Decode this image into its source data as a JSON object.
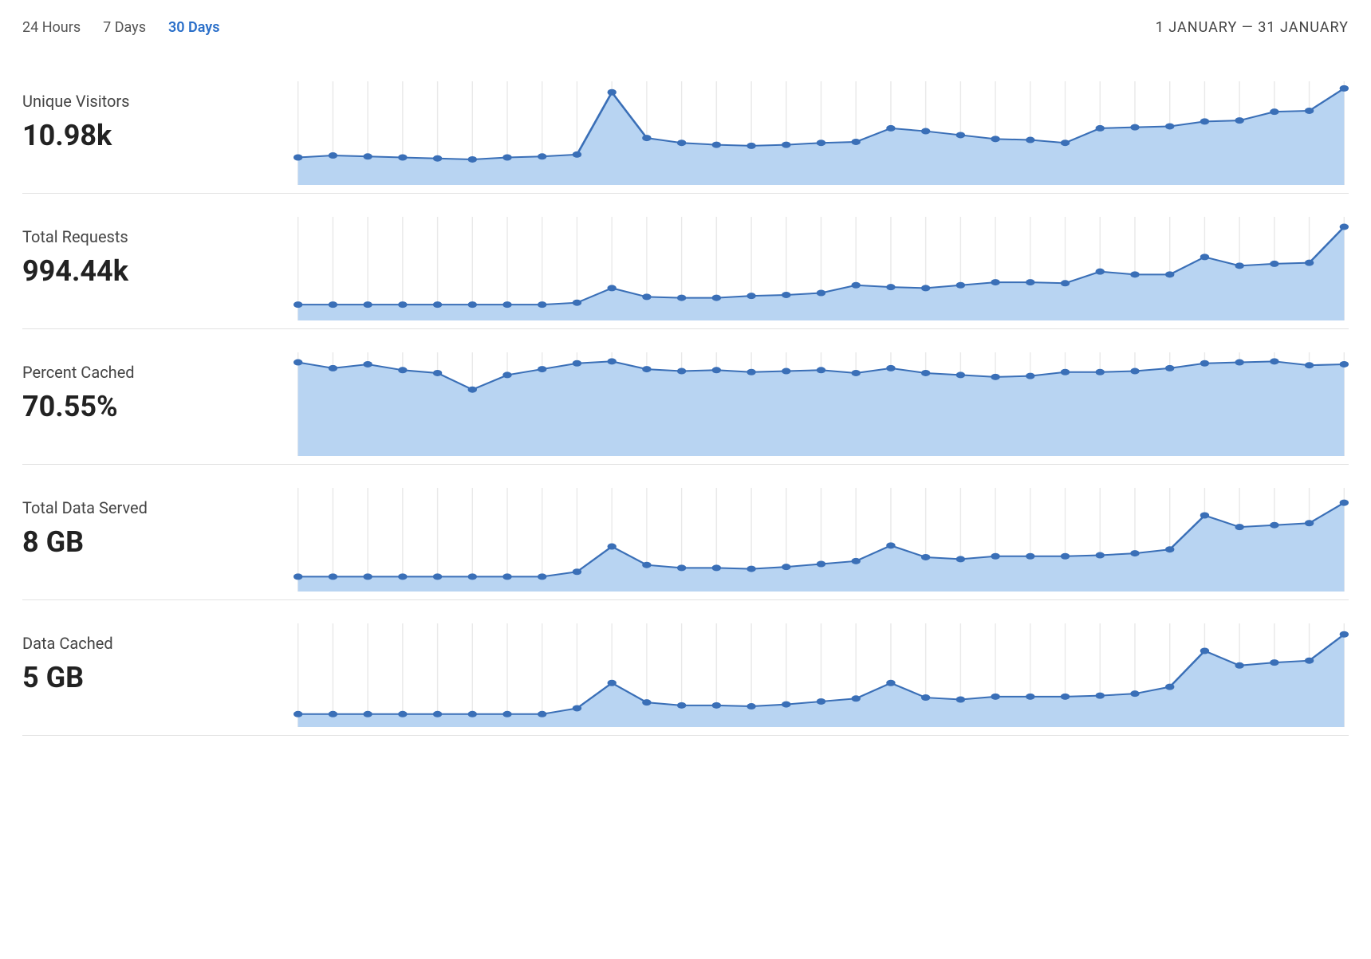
{
  "range_tabs": {
    "tab_24h": "24 Hours",
    "tab_7d": "7 Days",
    "tab_30d": "30 Days",
    "active": "tab_30d"
  },
  "date_range": "1 JANUARY — 31 JANUARY",
  "metrics": {
    "unique_visitors": {
      "title": "Unique Visitors",
      "value": "10.98k"
    },
    "total_requests": {
      "title": "Total Requests",
      "value": "994.44k"
    },
    "percent_cached": {
      "title": "Percent Cached",
      "value": "70.55%"
    },
    "total_data": {
      "title": "Total Data Served",
      "value": "8 GB"
    },
    "data_cached": {
      "title": "Data Cached",
      "value": "5 GB"
    }
  },
  "chart_data": [
    {
      "type": "area",
      "title": "Unique Visitors",
      "ylim": [
        0,
        100
      ],
      "x": [
        1,
        2,
        3,
        4,
        5,
        6,
        7,
        8,
        9,
        10,
        11,
        12,
        13,
        14,
        15,
        16,
        17,
        18,
        19,
        20,
        21,
        22,
        23,
        24,
        25,
        26,
        27,
        28,
        29,
        30,
        31
      ],
      "values": [
        25,
        27,
        26,
        25,
        24,
        23,
        25,
        26,
        28,
        92,
        45,
        40,
        38,
        37,
        38,
        40,
        41,
        55,
        52,
        48,
        44,
        43,
        40,
        55,
        56,
        57,
        62,
        63,
        72,
        73,
        96
      ]
    },
    {
      "type": "area",
      "title": "Total Requests",
      "ylim": [
        0,
        100
      ],
      "x": [
        1,
        2,
        3,
        4,
        5,
        6,
        7,
        8,
        9,
        10,
        11,
        12,
        13,
        14,
        15,
        16,
        17,
        18,
        19,
        20,
        21,
        22,
        23,
        24,
        25,
        26,
        27,
        28,
        29,
        30,
        31
      ],
      "values": [
        13,
        13,
        13,
        13,
        13,
        13,
        13,
        13,
        15,
        30,
        21,
        20,
        20,
        22,
        23,
        25,
        33,
        31,
        30,
        33,
        36,
        36,
        35,
        47,
        44,
        44,
        62,
        53,
        55,
        56,
        93
      ]
    },
    {
      "type": "area",
      "title": "Percent Cached",
      "ylim": [
        0,
        100
      ],
      "x": [
        1,
        2,
        3,
        4,
        5,
        6,
        7,
        8,
        9,
        10,
        11,
        12,
        13,
        14,
        15,
        16,
        17,
        18,
        19,
        20,
        21,
        22,
        23,
        24,
        25,
        26,
        27,
        28,
        29,
        30,
        31
      ],
      "values": [
        93,
        87,
        91,
        85,
        82,
        65,
        80,
        86,
        92,
        94,
        86,
        84,
        85,
        83,
        84,
        85,
        82,
        87,
        82,
        80,
        78,
        79,
        83,
        83,
        84,
        87,
        92,
        93,
        94,
        90,
        91
      ]
    },
    {
      "type": "area",
      "title": "Total Data Served",
      "ylim": [
        0,
        100
      ],
      "x": [
        1,
        2,
        3,
        4,
        5,
        6,
        7,
        8,
        9,
        10,
        11,
        12,
        13,
        14,
        15,
        16,
        17,
        18,
        19,
        20,
        21,
        22,
        23,
        24,
        25,
        26,
        27,
        28,
        29,
        30,
        31
      ],
      "values": [
        12,
        12,
        12,
        12,
        12,
        12,
        12,
        12,
        17,
        43,
        24,
        21,
        21,
        20,
        22,
        25,
        28,
        44,
        32,
        30,
        33,
        33,
        33,
        34,
        36,
        40,
        75,
        63,
        65,
        67,
        88
      ]
    },
    {
      "type": "area",
      "title": "Data Cached",
      "ylim": [
        0,
        100
      ],
      "x": [
        1,
        2,
        3,
        4,
        5,
        6,
        7,
        8,
        9,
        10,
        11,
        12,
        13,
        14,
        15,
        16,
        17,
        18,
        19,
        20,
        21,
        22,
        23,
        24,
        25,
        26,
        27,
        28,
        29,
        30,
        31
      ],
      "values": [
        10,
        10,
        10,
        10,
        10,
        10,
        10,
        10,
        16,
        42,
        22,
        19,
        19,
        18,
        20,
        23,
        26,
        42,
        27,
        25,
        28,
        28,
        28,
        29,
        31,
        38,
        75,
        60,
        63,
        65,
        92
      ]
    }
  ]
}
